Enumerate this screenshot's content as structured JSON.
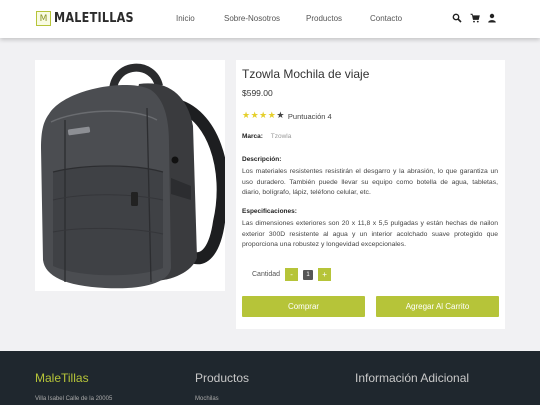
{
  "brand": {
    "logo_letter": "M",
    "name": "MALETILLAS"
  },
  "nav": {
    "items": [
      "Inicio",
      "Sobre-Nosotros",
      "Productos",
      "Contacto"
    ]
  },
  "icons": [
    "search-icon",
    "cart-icon",
    "user-icon"
  ],
  "product": {
    "title": "Tzowla Mochila de viaje",
    "price": "$599.00",
    "stars_filled": 4,
    "stars_total": 5,
    "rating_label": "Puntuación 4",
    "brand_label": "Marca:",
    "brand_value": "Tzowla",
    "description_label": "Descripción:",
    "description": "Los materiales resistentes resistirán el desgarro y la abrasión, lo que garantiza un uso duradero. También puede llevar su equipo como botella de agua, tabletas, diario, bolígrafo, lápiz, teléfono celular, etc.",
    "specs_label": "Especificaciones:",
    "specs": "Las dimensiones exteriores son 20 x 11,8 x 5,5 pulgadas y están hechas de nailon exterior 300D resistente al agua y un interior acolchado suave protegido que proporciona una robustez y longevidad excepcionales.",
    "quantity_label": "Cantidad",
    "quantity_value": "1",
    "minus_label": "-",
    "plus_label": "+",
    "buy_label": "Comprar",
    "add_cart_label": "Agregar Al Carrito"
  },
  "footer": {
    "brand": "MaleTillas",
    "col2_title": "Productos",
    "col3_title": "Información Adicional",
    "address": "Villa Isabel Calle de la 20005",
    "col2_first": "Mochilas"
  },
  "colors": {
    "accent": "#b6c439",
    "footer_bg": "#1f272e",
    "star": "#e5cf2a"
  }
}
